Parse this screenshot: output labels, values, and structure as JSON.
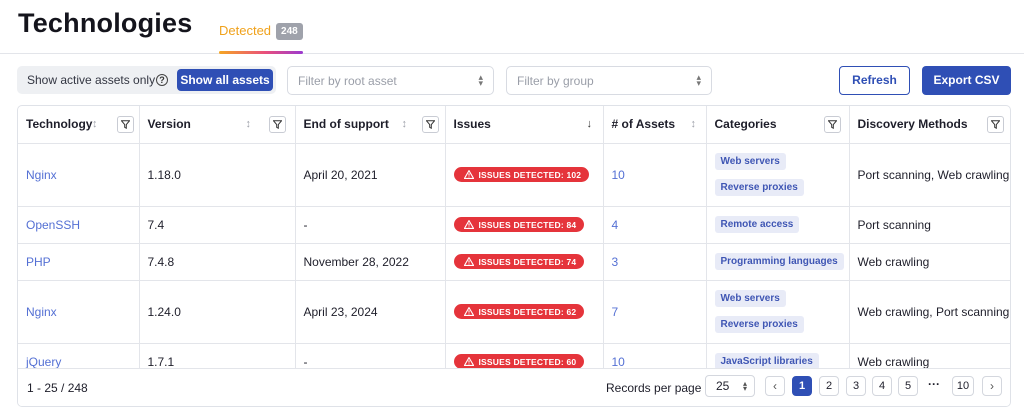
{
  "page": {
    "title": "Technologies"
  },
  "tabs": {
    "detected_label": "Detected",
    "detected_count": "248"
  },
  "toolbar": {
    "active_only_label": "Show active assets only",
    "help_icon": "question-circle-icon",
    "show_all_label": "Show all assets",
    "filter_root_placeholder": "Filter by root asset",
    "filter_group_placeholder": "Filter by group",
    "refresh_label": "Refresh",
    "export_label": "Export CSV"
  },
  "columns": {
    "technology": "Technology",
    "version": "Version",
    "end_of_support": "End of support",
    "issues": "Issues",
    "assets": "# of Assets",
    "categories": "Categories",
    "discovery": "Discovery Methods"
  },
  "rows": [
    {
      "technology": "Nginx",
      "version": "1.18.0",
      "end_of_support": "April 20, 2021",
      "issues": "ISSUES DETECTED: 102",
      "assets": "10",
      "categories": [
        "Web servers",
        "Reverse proxies"
      ],
      "discovery": "Port scanning, Web crawling"
    },
    {
      "technology": "OpenSSH",
      "version": "7.4",
      "end_of_support": "-",
      "issues": "ISSUES DETECTED: 84",
      "assets": "4",
      "categories": [
        "Remote access"
      ],
      "discovery": "Port scanning"
    },
    {
      "technology": "PHP",
      "version": "7.4.8",
      "end_of_support": "November 28, 2022",
      "issues": "ISSUES DETECTED: 74",
      "assets": "3",
      "categories": [
        "Programming languages"
      ],
      "discovery": "Web crawling"
    },
    {
      "technology": "Nginx",
      "version": "1.24.0",
      "end_of_support": "April 23, 2024",
      "issues": "ISSUES DETECTED: 62",
      "assets": "7",
      "categories": [
        "Web servers",
        "Reverse proxies"
      ],
      "discovery": "Web crawling, Port scanning"
    },
    {
      "technology": "jQuery",
      "version": "1.7.1",
      "end_of_support": "-",
      "issues": "ISSUES DETECTED: 60",
      "assets": "10",
      "categories": [
        "JavaScript libraries"
      ],
      "discovery": "Web crawling"
    }
  ],
  "footer": {
    "range": "1 - 25 / 248",
    "records_per_page_label": "Records per page",
    "records_per_page_value": "25",
    "pages": [
      "1",
      "2",
      "3",
      "4",
      "5"
    ],
    "ellipsis": "···",
    "last_page": "10",
    "prev_icon": "chevron-left-icon",
    "next_icon": "chevron-right-icon"
  },
  "colors": {
    "primary": "#2f4fb5",
    "link": "#5470d4",
    "danger": "#e5343b",
    "tab_accent": "#f0a21c"
  }
}
